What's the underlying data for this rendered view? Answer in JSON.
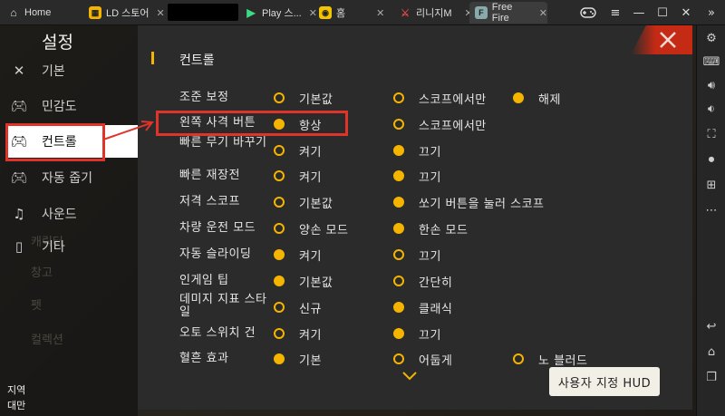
{
  "tabs": [
    {
      "label": "Home",
      "icon": "home-icon"
    },
    {
      "label": "LD 스토어",
      "icon": "ld-store-icon"
    },
    {
      "label": "Play 스...",
      "icon": "play-store-icon"
    },
    {
      "label": "홈",
      "icon": "app-home-icon"
    },
    {
      "label": "리니지M",
      "icon": "lineage-icon"
    },
    {
      "label": "Free Fire",
      "icon": "free-fire-icon"
    }
  ],
  "settings": {
    "title": "설정",
    "menu": [
      {
        "label": "기본",
        "icon": "tools-icon"
      },
      {
        "label": "민감도",
        "icon": "gamepad-icon"
      },
      {
        "label": "컨트롤",
        "icon": "gamepad-icon"
      },
      {
        "label": "자동 줍기",
        "icon": "gamepad-icon"
      },
      {
        "label": "사운드",
        "icon": "music-icon"
      },
      {
        "label": "기타",
        "icon": "phone-icon"
      }
    ],
    "background_menu": [
      "캐릭터",
      "창고",
      "펫",
      "컬렉션"
    ],
    "region_label": "지역",
    "region_value": "대만"
  },
  "panel": {
    "section_title": "컨트롤",
    "rows": [
      {
        "label": "조준 보정",
        "options": [
          "기본값",
          "스코프에서만",
          "해제"
        ],
        "selected": 2
      },
      {
        "label": "왼쪽 사격 버튼",
        "options": [
          "항상",
          "스코프에서만"
        ],
        "selected": 0
      },
      {
        "label": "빠른 무기 바꾸기",
        "options": [
          "켜기",
          "끄기"
        ],
        "selected": 1
      },
      {
        "label": "빠른 재장전",
        "options": [
          "켜기",
          "끄기"
        ],
        "selected": 1
      },
      {
        "label": "저격 스코프",
        "options": [
          "기본값",
          "쏘기 버튼을 눌러 스코프"
        ],
        "selected": 1
      },
      {
        "label": "차량 운전 모드",
        "options": [
          "양손 모드",
          "한손 모드"
        ],
        "selected": 1
      },
      {
        "label": "자동 슬라이딩",
        "options": [
          "켜기",
          "끄기"
        ],
        "selected": 0
      },
      {
        "label": "인게임 팁",
        "options": [
          "기본값",
          "간단히"
        ],
        "selected": 0
      },
      {
        "label": "데미지 지표 스타일",
        "options": [
          "신규",
          "클래식"
        ],
        "selected": 1
      },
      {
        "label": "오토 스위치 건",
        "options": [
          "켜기",
          "끄기"
        ],
        "selected": 1
      },
      {
        "label": "혈흔 효과",
        "options": [
          "기본",
          "어둡게",
          "노 블러드"
        ],
        "selected": 0
      }
    ],
    "hud_button": "사용자 지정 HUD"
  },
  "colors": {
    "accent": "#f4b400",
    "highlight": "#e0332a",
    "close": "#c42a14"
  }
}
